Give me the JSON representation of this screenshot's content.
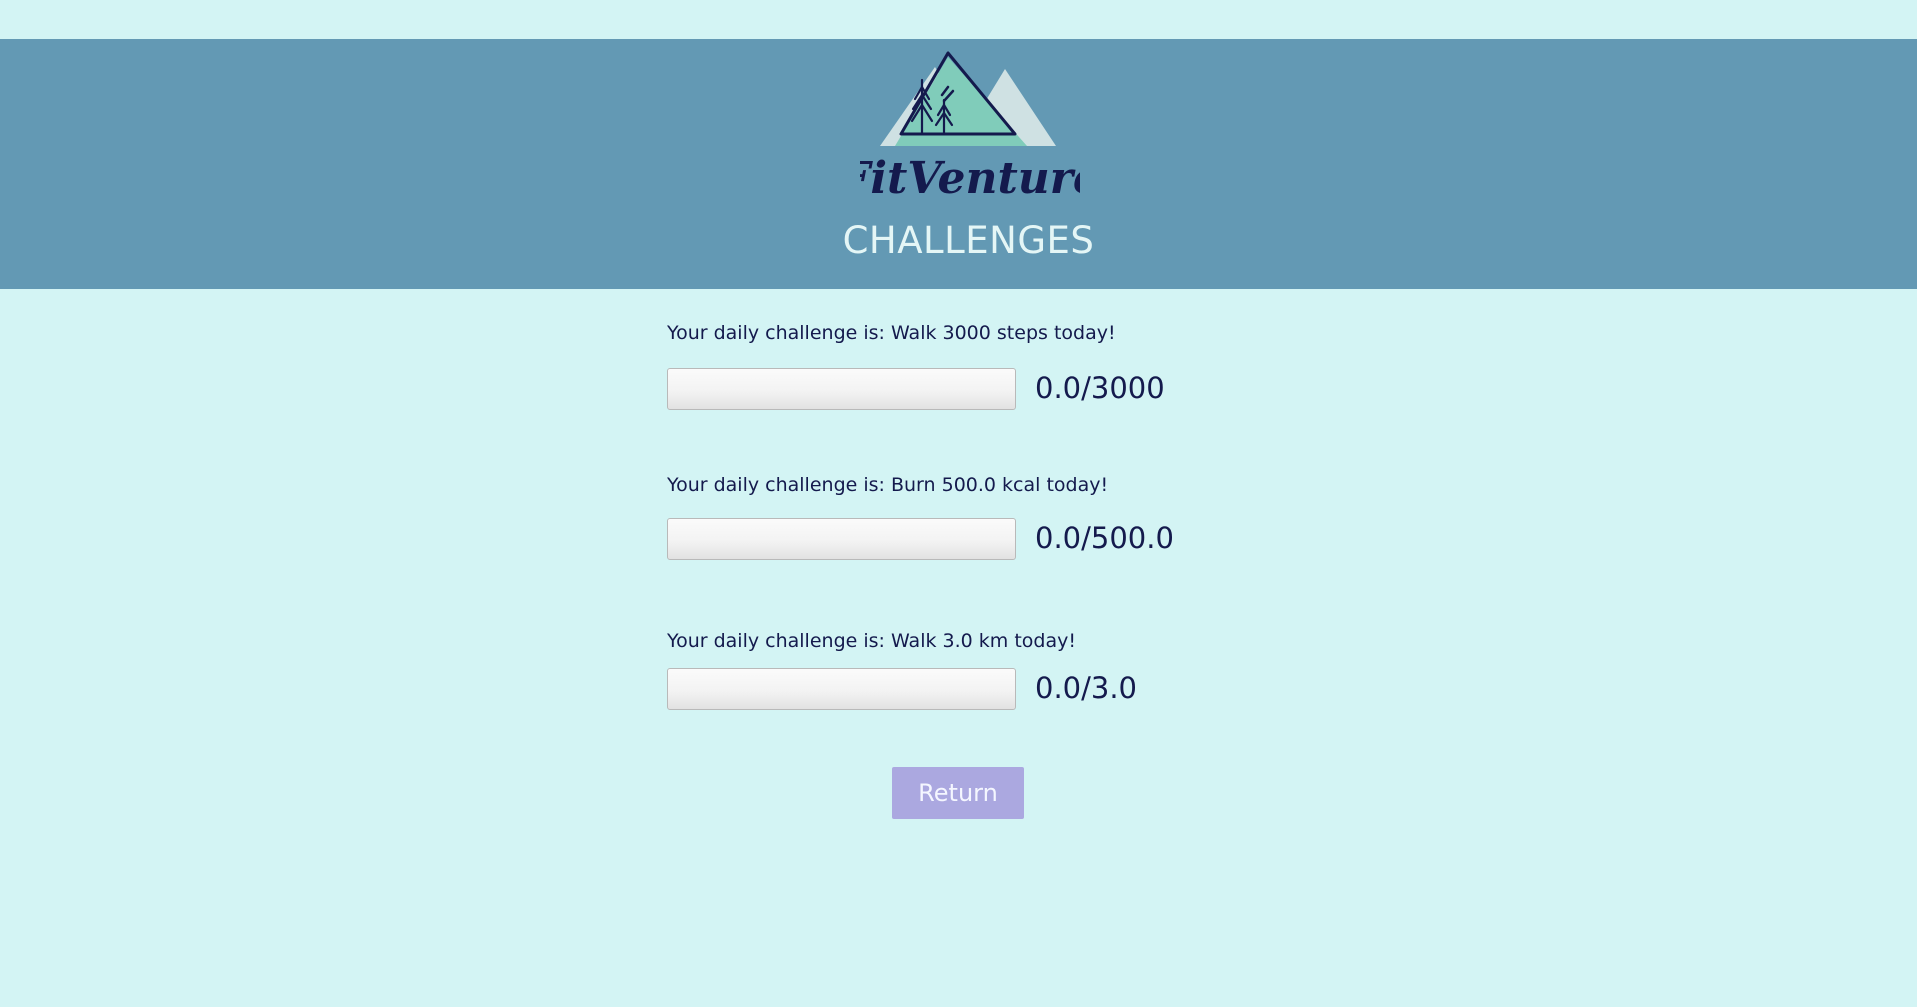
{
  "header": {
    "logo_text": "FitVenture",
    "page_title": "CHALLENGES",
    "logo_icon": "mountain-pines-logo-icon"
  },
  "challenges": [
    {
      "text": "Your daily challenge is: Walk 3000 steps today!",
      "count": "0.0/3000",
      "progress": 0.0
    },
    {
      "text": "Your daily challenge is: Burn 500.0 kcal today!",
      "count": "0.0/500.0",
      "progress": 0.0
    },
    {
      "text": "Your daily challenge is: Walk 3.0 km today!",
      "count": "0.0/3.0",
      "progress": 0.0
    }
  ],
  "return_button": {
    "label": "Return"
  },
  "colors": {
    "background": "#d3f4f4",
    "header": "#6399b4",
    "text": "#141a4d",
    "button": "#aba8e0"
  }
}
